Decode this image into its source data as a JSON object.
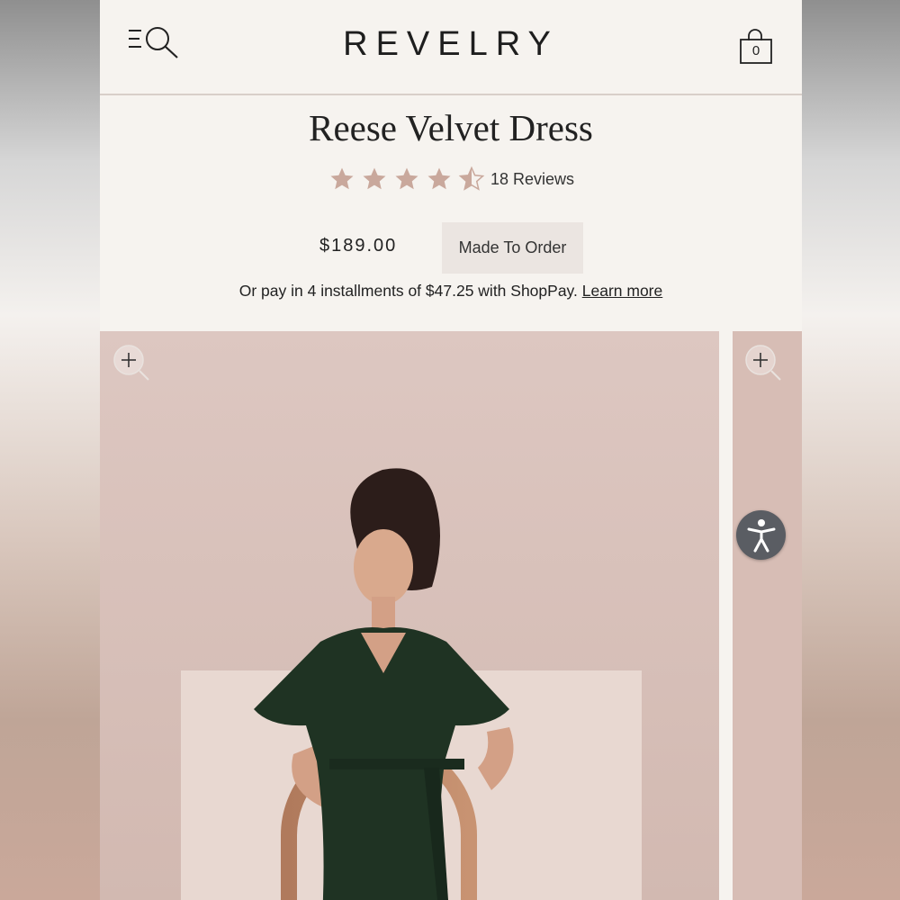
{
  "header": {
    "logo": "REVELRY",
    "cart_count": "0",
    "menu_icon": "menu-search-icon",
    "cart_icon": "shopping-bag-icon"
  },
  "product": {
    "title": "Reese Velvet Dress",
    "rating": 4.5,
    "rating_max": 5,
    "reviews_label": "18 Reviews",
    "price": "$189.00",
    "badge": "Made To Order",
    "installments_text": "Or pay in 4 installments of $47.25 with ShopPay.",
    "learn_more": "Learn more"
  },
  "gallery": {
    "zoom_icon": "zoom-in-icon"
  },
  "accessibility": {
    "icon": "accessibility-icon"
  },
  "colors": {
    "star": "#c9a89c",
    "page_bg": "#f6f3ef",
    "photo_bg": "#dcc6c0",
    "dress": "#1f3323"
  }
}
